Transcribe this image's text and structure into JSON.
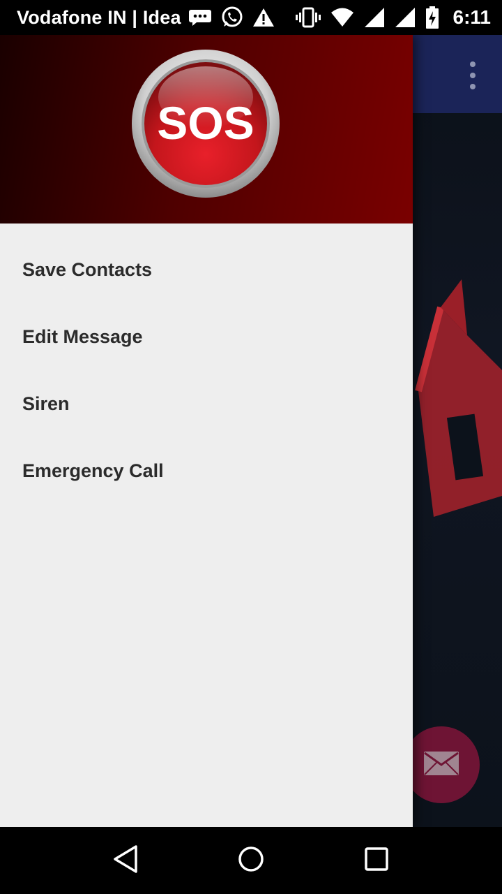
{
  "status_bar": {
    "carrier": "Vodafone IN | Idea",
    "time": "6:11",
    "left_icons": [
      "message-icon",
      "whatsapp-icon",
      "warning-icon"
    ],
    "right_icons": [
      "vibrate-icon",
      "wifi-icon",
      "signal-icon",
      "signal-icon",
      "battery-charging-icon"
    ]
  },
  "drawer": {
    "logo_text": "SOS",
    "menu_items": [
      {
        "label": "Save Contacts"
      },
      {
        "label": "Edit Message"
      },
      {
        "label": "Siren"
      },
      {
        "label": "Emergency Call"
      }
    ]
  },
  "app": {
    "overflow_icon": "more-vert-icon",
    "fab_icon": "mail-icon"
  },
  "colors": {
    "drawer_header_dark": "#1a0000",
    "drawer_header_light": "#7a0000",
    "toolbar": "#1b2458",
    "fab": "#6e1434",
    "drawer_bg": "#eeeeee"
  },
  "nav_bar": {
    "buttons": [
      "back-icon",
      "home-icon",
      "recents-icon"
    ]
  }
}
